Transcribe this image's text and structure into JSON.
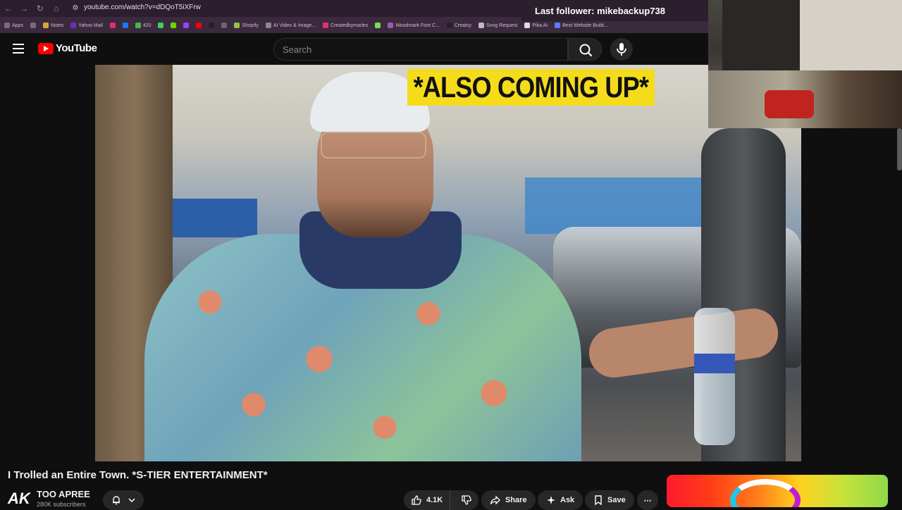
{
  "browser": {
    "url": "youtube.com/watch?v=dDQoT5iXFrw",
    "nav": {
      "back": "←",
      "forward": "→",
      "reload": "↻",
      "home": "⌂"
    }
  },
  "stream_overlay": {
    "last_follower": "Last follower: mikebackup738"
  },
  "bookmarks": [
    {
      "label": "Apps",
      "color": "#7a6a7c"
    },
    {
      "label": "",
      "color": "#7a6a7c"
    },
    {
      "label": "Notes",
      "color": "#d9a63a"
    },
    {
      "label": "Yahoo Mail",
      "color": "#6a2fbf"
    },
    {
      "label": "",
      "color": "#e1306c"
    },
    {
      "label": "",
      "color": "#1877f2"
    },
    {
      "label": "420",
      "color": "#4caf50"
    },
    {
      "label": "",
      "color": "#39d353"
    },
    {
      "label": "",
      "color": "#6bd900"
    },
    {
      "label": "",
      "color": "#9146ff"
    },
    {
      "label": "",
      "color": "#ff0000"
    },
    {
      "label": "",
      "color": "#222222"
    },
    {
      "label": "",
      "color": "#666666"
    },
    {
      "label": "Shopify",
      "color": "#95bf47"
    },
    {
      "label": "AI Video & Image...",
      "color": "#888888"
    },
    {
      "label": "Createdbymarles",
      "color": "#e1306c"
    },
    {
      "label": "",
      "color": "#7ed957"
    },
    {
      "label": "Woodmark Font C...",
      "color": "#9b59b6"
    },
    {
      "label": "Creatsy",
      "color": "#222222"
    },
    {
      "label": "Song Request",
      "color": "#bbbbbb"
    },
    {
      "label": "Pika AI",
      "color": "#dddddd"
    },
    {
      "label": "Best Website Build...",
      "color": "#5b7cff"
    }
  ],
  "header": {
    "logo_text": "YouTube",
    "search_placeholder": "Search"
  },
  "video": {
    "caption_overlay": "*ALSO COMING UP*",
    "title": "I Trolled an Entire Town. *S-TIER ENTERTAINMENT*"
  },
  "channel": {
    "avatar_text": "AK",
    "name": "TOO APREE",
    "subscribers": "280K subscribers"
  },
  "actions": {
    "likes": "4.1K",
    "share": "Share",
    "ask": "Ask",
    "save": "Save",
    "more": "⋯"
  },
  "colors": {
    "accent": "#ff0000",
    "caption_bg": "#f5dc1a",
    "chrome_bg": "#3b2a3d"
  }
}
